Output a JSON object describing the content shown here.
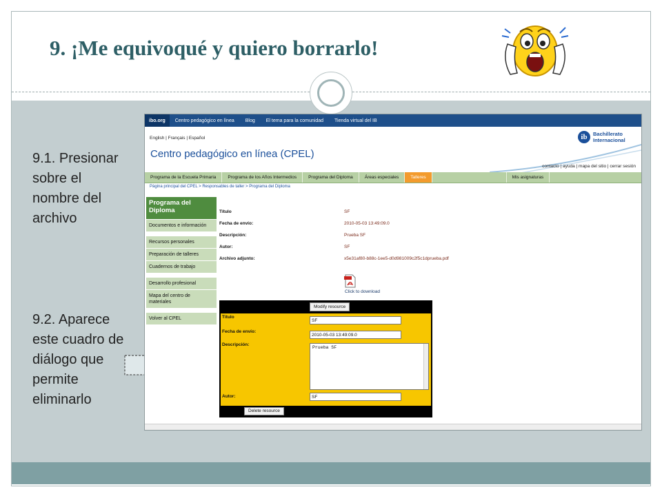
{
  "slide": {
    "title": "9. ¡Me equivoqué y quiero borrarlo!",
    "step1": "9.1. Presionar sobre el nombre del archivo",
    "step2": "9.2. Aparece este cuadro de diálogo que permite eliminarlo"
  },
  "browser": {
    "topnav": {
      "logo": "ibo.org",
      "links": [
        "Centro pedagógico en línea",
        "Blog",
        "El tema para la comunidad",
        "Tienda virtual del IB"
      ]
    },
    "languages": "English | Français | Español",
    "site_title": "Centro pedagógico en línea (CPEL)",
    "brand": {
      "mark": "ib",
      "line1": "Bachillerato",
      "line2": "Internacional"
    },
    "utility_links": "contacto | ayuda | mapa del sitio | cerrar sesión",
    "program_tabs": [
      "Programa de la Escuela Primaria",
      "Programa de los Años Intermedios",
      "Programa del Diploma",
      "Áreas especiales",
      "Talleres"
    ],
    "my_subjects": "Mis asignaturas",
    "breadcrumb": "Página principal del CPEL > Responsables de taller > Programa del Diploma",
    "sidemenu": {
      "header": "Programa del Diploma",
      "items": [
        "Documentos e información",
        "Recursos personales",
        "Preparación de talleres",
        "Cuadernos de trabajo",
        "Desarrollo profesional",
        "Mapa del centro de materiales",
        "Volver al CPEL"
      ]
    },
    "details": {
      "rows": [
        {
          "label": "Título",
          "value": "SF"
        },
        {
          "label": "Fecha de envío:",
          "value": "2010-05-03 13:49:09.0"
        },
        {
          "label": "Descripción:",
          "value": "Prueba SF"
        },
        {
          "label": "Autor:",
          "value": "SF"
        },
        {
          "label": "Archivo adjunto:",
          "value": "x5e31af80-b88c-1ee5-d0d981009c2f5c1dprueba.pdf"
        }
      ],
      "download": "Click to download"
    },
    "dialog": {
      "modify_button": "Modify resource",
      "title_label": "Título",
      "title_value": "SF",
      "date_label": "Fecha de envío:",
      "date_value": "2010-05-03 13:49:09.0",
      "description_label": "Descripción:",
      "description_value": "Prueba SF",
      "author_label": "Autor:",
      "author_value": "SF",
      "delete_button": "Delete resource"
    }
  }
}
